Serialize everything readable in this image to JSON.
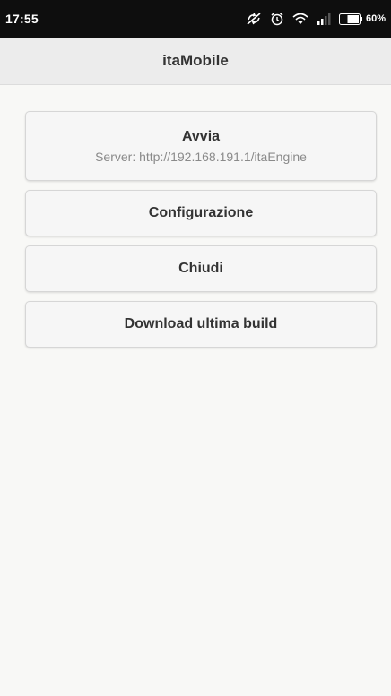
{
  "status_bar": {
    "time": "17:55",
    "battery_percent": "60%",
    "icons": [
      "sync-disabled-icon",
      "alarm-icon",
      "wifi-icon",
      "signal-icon",
      "battery-icon"
    ]
  },
  "app_bar": {
    "title": "itaMobile"
  },
  "menu": {
    "start": {
      "label": "Avvia",
      "server": "Server: http://192.168.191.1/itaEngine"
    },
    "config_label": "Configurazione",
    "close_label": "Chiudi",
    "download_label": "Download ultima build"
  },
  "colors": {
    "status_bar_bg": "#0e0e0e",
    "app_bar_bg": "#ececec",
    "page_bg": "#f8f8f6",
    "button_bg": "#f6f6f6"
  }
}
